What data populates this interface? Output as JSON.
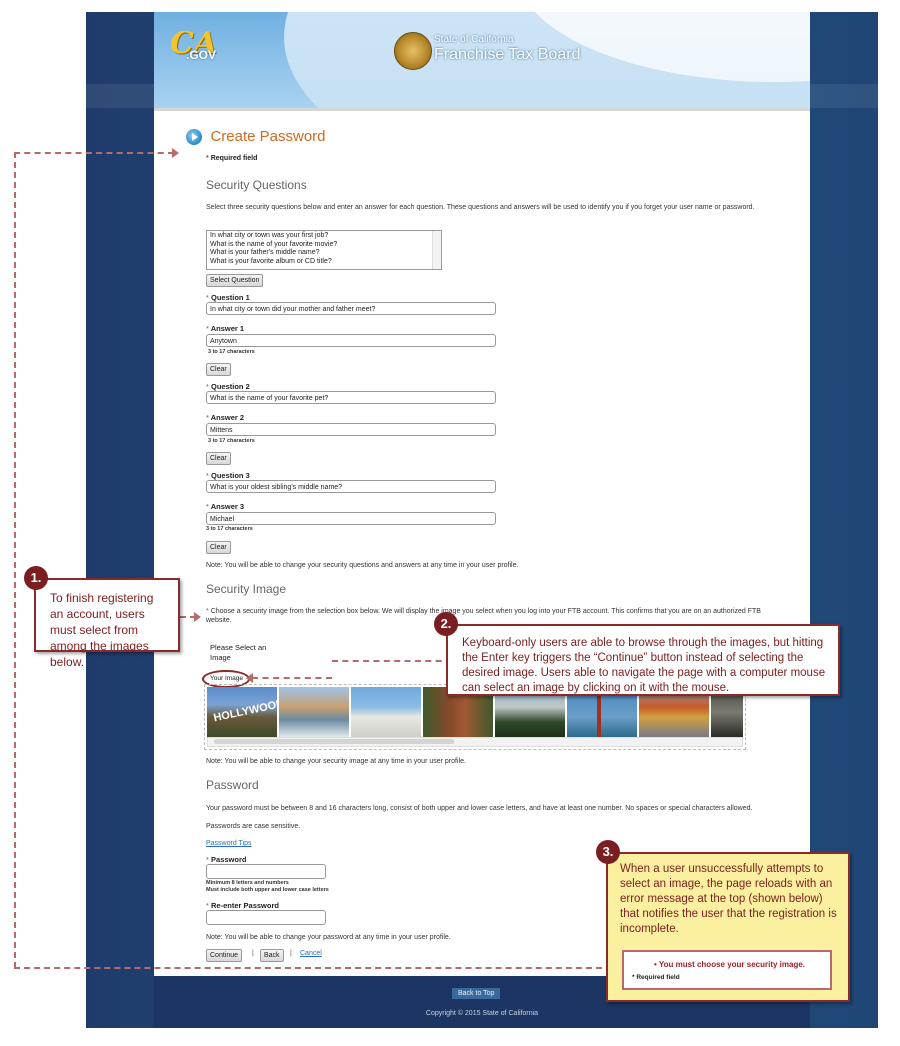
{
  "header": {
    "ca_logo": "CA",
    "ca_logo_suffix": ".GOV",
    "agency_small": "State of California",
    "agency_big": "Franchise Tax Board"
  },
  "page": {
    "title": "Create Password",
    "required_note": "Required field",
    "required_star": "*"
  },
  "security_questions": {
    "heading": "Security Questions",
    "intro": "Select three security questions below and enter an answer for each question. These questions and answers will be used to identify you if you forget your user name or password.",
    "options": [
      "In what city or town was your first job?",
      "What is the name of your favorite movie?",
      "What is your father's middle name?",
      "What is your favorite album or CD title?"
    ],
    "select_button": "Select Question",
    "items": [
      {
        "question_label": "Question 1",
        "question_value": "In what city or town did your mother and father meet?",
        "answer_label": "Answer 1",
        "answer_value": "Anytown",
        "hint": "3 to 17 characters",
        "clear": "Clear"
      },
      {
        "question_label": "Question 2",
        "question_value": "What is the name of your favorite pet?",
        "answer_label": "Answer 2",
        "answer_value": "Mittens",
        "hint": "3 to 17 characters",
        "clear": "Clear"
      },
      {
        "question_label": "Question 3",
        "question_value": "What is your oldest sibling's middle name?",
        "answer_label": "Answer 3",
        "answer_value": "Michael",
        "hint": "3 to 17 characters",
        "clear": "Clear"
      }
    ],
    "note": "Note: You will be able to change your security questions and answers at any time in your user profile."
  },
  "security_image": {
    "heading": "Security Image",
    "intro": "Choose a security image from the selection box below. We will display the image you select when you log into your FTB account. This confirms that you are on an authorized FTB website.",
    "please_select": "Please Select an Image",
    "your_image": "Your Image",
    "thumbnails": [
      "hollywood-sign",
      "coastline",
      "state-capitol",
      "redwood-tree",
      "yosemite-valley",
      "golden-gate-bridge",
      "cable-car",
      "rocky-shore"
    ],
    "note": "Note: You will be able to change your security image at any time in your user profile."
  },
  "password": {
    "heading": "Password",
    "rules": "Your password must be between 8 and 16 characters long, consist of both upper and lower case letters, and have at least one number. No spaces or special characters allowed.",
    "case_note": "Passwords are case sensitive.",
    "tips_link": "Password Tips",
    "password_label": "Password",
    "password_value": "",
    "password_hint_1": "Minimum 8 letters and numbers",
    "password_hint_2": "Must include both upper and lower case letters",
    "reenter_label": "Re-enter Password",
    "reenter_value": "",
    "note": "Note: You will be able to change your password at any time in your user profile."
  },
  "actions": {
    "continue": "Continue",
    "back": "Back",
    "cancel": "Cancel",
    "separator": "|"
  },
  "footer": {
    "back_to_top": "Back to Top",
    "copyright": "Copyright © 2015 State of California"
  },
  "annotations": [
    {
      "number": "1.",
      "text": "To finish registering an account, users must select from among the images below."
    },
    {
      "number": "2.",
      "text": "Keyboard-only users are able to browse through the images, but hitting the Enter key triggers the “Continue” button instead of selecting the desired image. Users able to navigate the page with a computer mouse can select an image by clicking on it with the mouse."
    },
    {
      "number": "3.",
      "text": "When a user unsuccessfully attempts to select an image, the page reloads with an error message at the top (shown below) that notifies the user that the registration is incomplete.",
      "error_message": "You must choose your security image.",
      "error_required": "* Required field"
    }
  ],
  "colors": {
    "annotation": "#7a1e22",
    "title": "#d06a1e",
    "link": "#2a6ebb",
    "footer": "#1d3563",
    "error": "#a0202a",
    "annotation_highlight": "#fbf0a0"
  }
}
